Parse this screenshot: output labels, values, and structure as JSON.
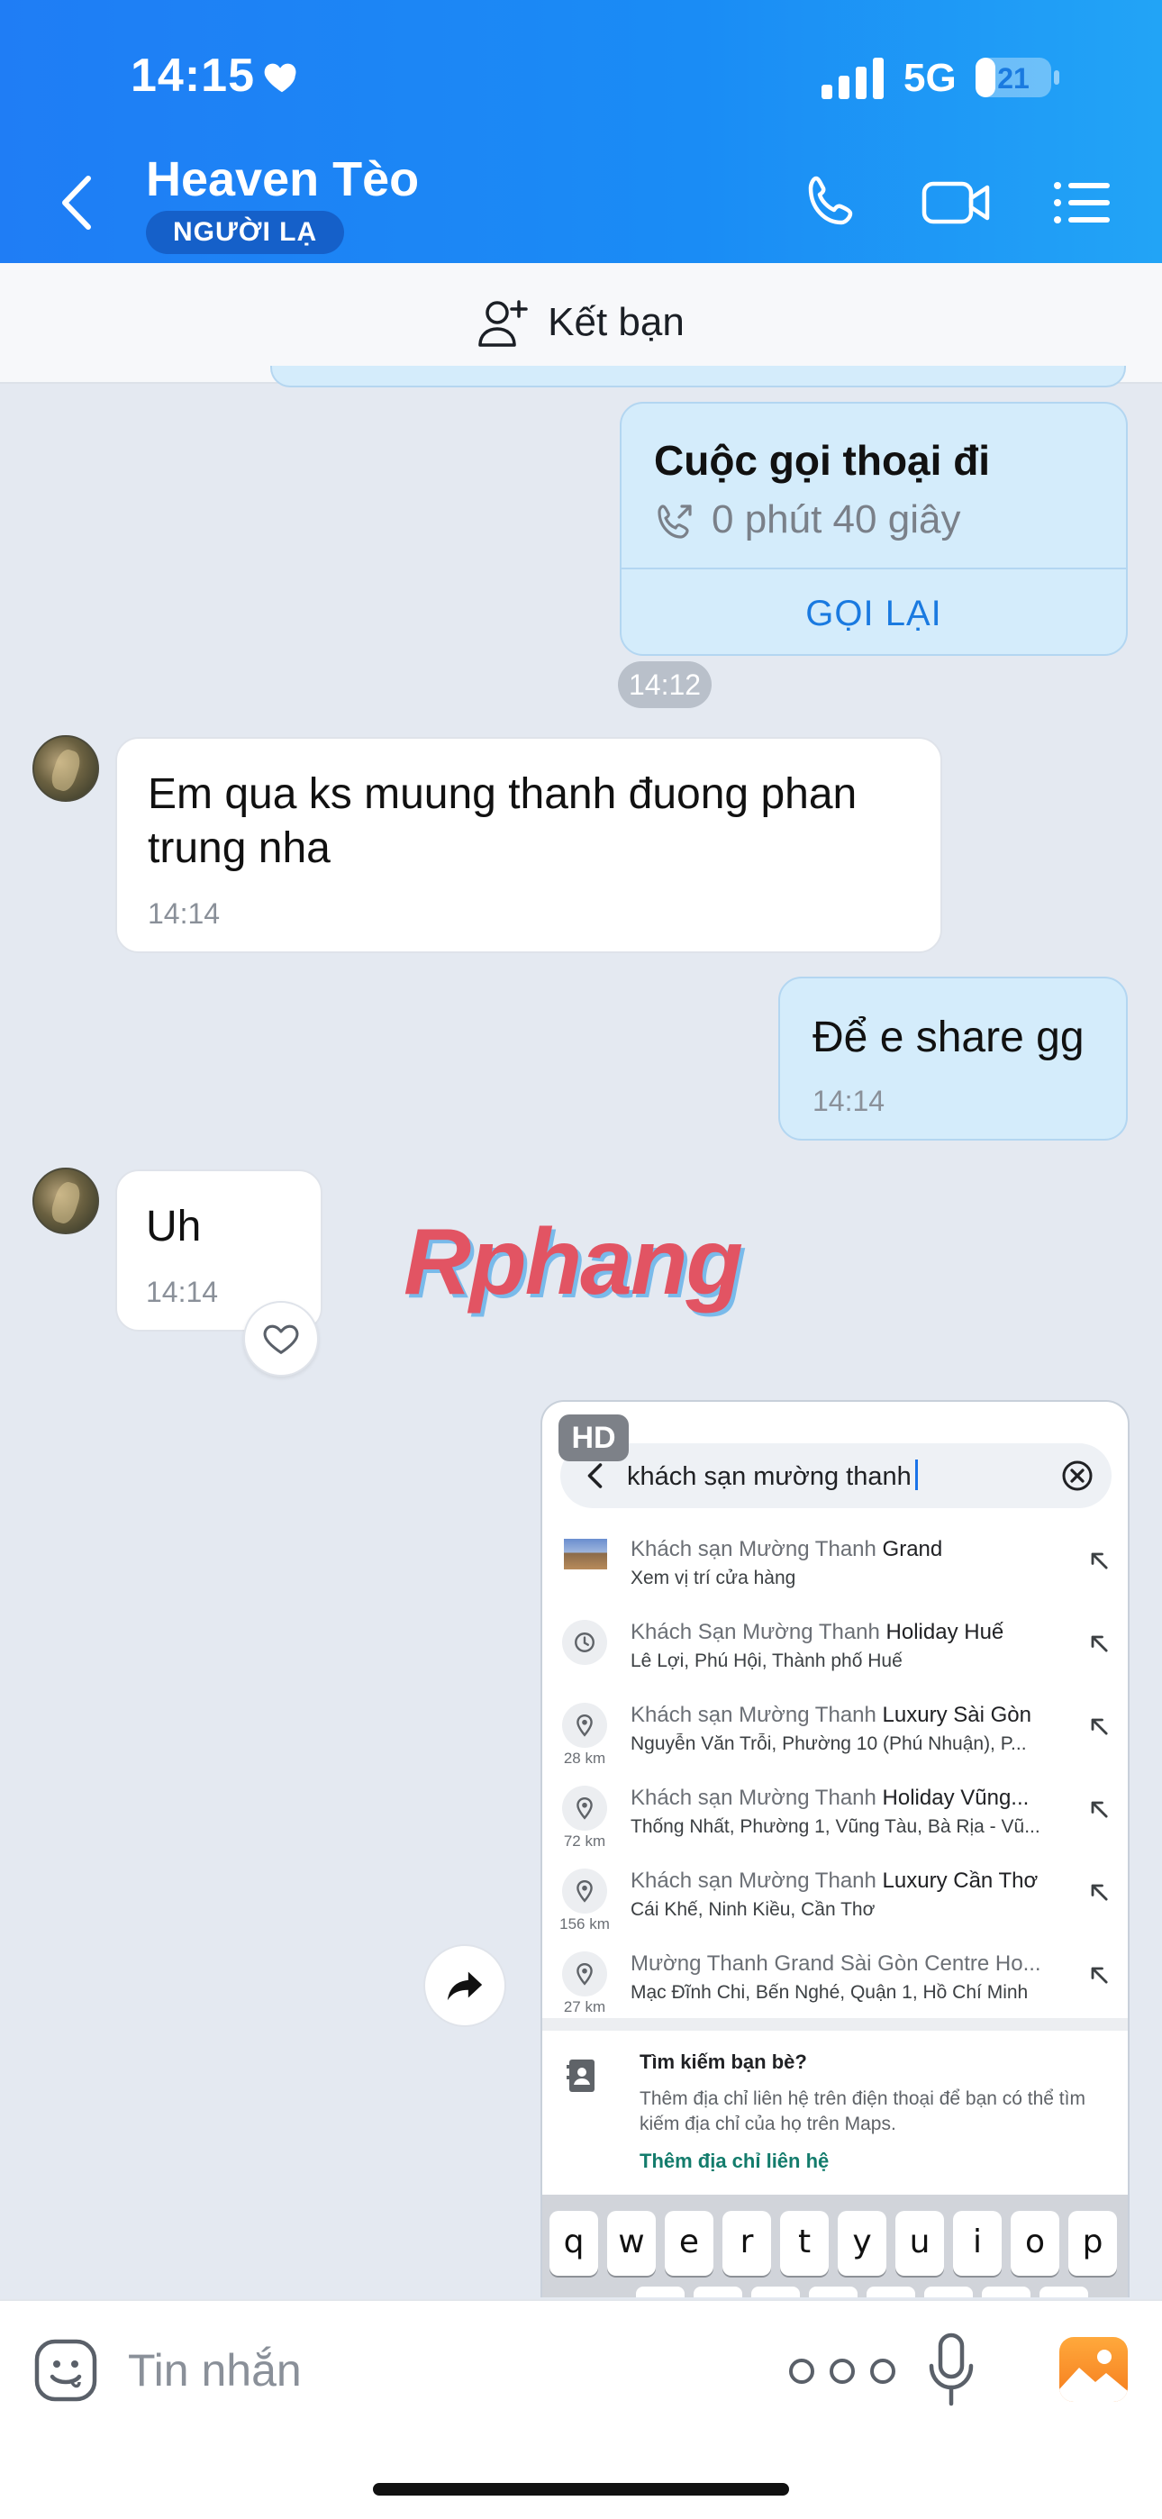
{
  "status_bar": {
    "time": "14:15",
    "network": "5G",
    "battery": "21"
  },
  "header": {
    "contact_name": "Heaven Tèo",
    "badge": "NGƯỜI LẠ"
  },
  "add_friend": {
    "label": "Kết bạn"
  },
  "messages": {
    "call": {
      "title": "Cuộc gọi thoại đi",
      "duration": "0 phút 40 giây",
      "action": "GỌI LẠI",
      "time": "14:12"
    },
    "m1": {
      "text": "Em qua ks muung thanh đuong phan trung nha",
      "time": "14:14"
    },
    "m2": {
      "text": "Để e share gg",
      "time": "14:14"
    },
    "m3": {
      "text": "Uh",
      "time": "14:14"
    }
  },
  "watermark": "Rphang",
  "shared_image": {
    "badge": "HD",
    "query": "khách sạn mường thanh",
    "results": [
      {
        "prefix": "Khách sạn Mường Thanh ",
        "bold": "Grand",
        "addr": "Xem vị trí cửa hàng",
        "km": ""
      },
      {
        "prefix": "Khách Sạn Mường Thanh ",
        "bold": "Holiday Huế",
        "addr": "Lê Lợi, Phú Hội, Thành phố Huế",
        "km": ""
      },
      {
        "prefix": "Khách sạn Mường Thanh ",
        "bold": "Luxury Sài Gòn",
        "addr": "Nguyễn Văn Trỗi, Phường 10 (Phú Nhuận), P...",
        "km": "28 km"
      },
      {
        "prefix": "Khách sạn Mường Thanh ",
        "bold": "Holiday Vũng...",
        "addr": "Thống Nhất, Phường 1, Vũng Tàu, Bà Rịa - Vũ...",
        "km": "72 km"
      },
      {
        "prefix": "Khách sạn Mường Thanh ",
        "bold": "Luxury Cần Thơ",
        "addr": "Cái Khế, Ninh Kiều, Cần Thơ",
        "km": "156 km"
      },
      {
        "prefix": "Mường Thanh Grand Sài Gòn Centre Ho...",
        "bold": "",
        "addr": "Mạc Đĩnh Chi, Bến Nghé, Quận 1, Hồ Chí Minh",
        "km": "27 km"
      }
    ],
    "find_friends": {
      "title": "Tìm kiếm bạn bè?",
      "desc": "Thêm địa chỉ liên hệ trên điện thoại để bạn có thể tìm kiếm địa chỉ của họ trên Maps.",
      "link": "Thêm địa chỉ liên hệ"
    },
    "keys": [
      "q",
      "w",
      "e",
      "r",
      "t",
      "y",
      "u",
      "i",
      "o",
      "p"
    ]
  },
  "input_bar": {
    "placeholder": "Tin nhắn"
  },
  "colors": {
    "header_start": "#1f7df5",
    "header_end": "#22a4f6",
    "outgoing_bubble": "#d4ecfb",
    "accent": "#1a7ae0"
  },
  "icons": [
    "heart-icon",
    "back-chevron-icon",
    "phone-icon",
    "video-icon",
    "list-icon",
    "add-user-icon",
    "phone-outgoing-icon",
    "share-forward-icon",
    "emoji-icon",
    "more-dots-icon",
    "mic-icon",
    "gallery-icon"
  ]
}
